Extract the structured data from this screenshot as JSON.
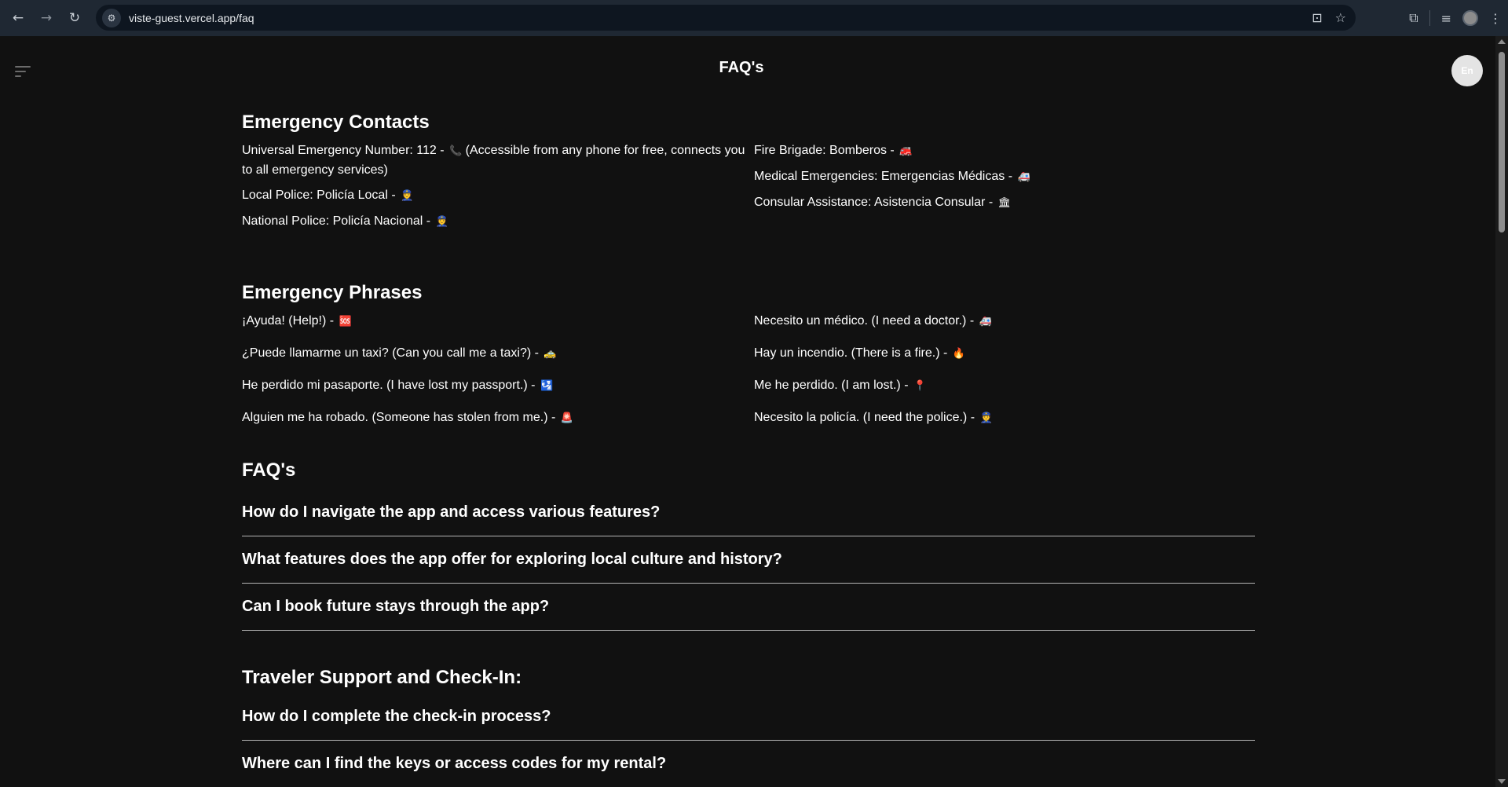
{
  "browser": {
    "url": "viste-guest.vercel.app/faq",
    "icons": [
      "back-arrow-icon",
      "forward-arrow-icon",
      "reload-icon",
      "site-info-icon",
      "install-app-icon",
      "bookmark-star-icon",
      "extensions-icon",
      "media-icon",
      "profile-avatar-icon",
      "more-menu-icon"
    ]
  },
  "header": {
    "title": "FAQ's",
    "language": "En"
  },
  "emergency_contacts": {
    "title": "Emergency Contacts",
    "left": [
      {
        "text": "Universal Emergency Number: 112 - ",
        "emoji": "📞",
        "tail": " (Accessible from any phone for free, connects you to all emergency services)"
      },
      {
        "text": "Local Police: Policía Local - ",
        "emoji": "👮"
      },
      {
        "text": "National Police: Policía Nacional - ",
        "emoji": "👮"
      }
    ],
    "right": [
      {
        "text": "Fire Brigade: Bomberos - ",
        "emoji": "🚒"
      },
      {
        "text": "Medical Emergencies: Emergencias Médicas - ",
        "emoji": "🚑"
      },
      {
        "text": "Consular Assistance: Asistencia Consular - ",
        "emoji": "🏛"
      }
    ]
  },
  "emergency_phrases": {
    "title": "Emergency Phrases",
    "left": [
      {
        "text": "¡Ayuda! (Help!) - ",
        "emoji": "🆘"
      },
      {
        "text": "¿Puede llamarme un taxi? (Can you call me a taxi?) - ",
        "emoji": "🚕"
      },
      {
        "text": "He perdido mi pasaporte. (I have lost my passport.) - ",
        "emoji": "🛂"
      },
      {
        "text": "Alguien me ha robado. (Someone has stolen from me.) - ",
        "emoji": "🚨"
      }
    ],
    "right": [
      {
        "text": "Necesito un médico. (I need a doctor.) - ",
        "emoji": "🚑"
      },
      {
        "text": "Hay un incendio. (There is a fire.) - ",
        "emoji": "🔥"
      },
      {
        "text": "Me he perdido. (I am lost.) - ",
        "emoji": "📍"
      },
      {
        "text": "Necesito la policía. (I need the police.) - ",
        "emoji": "👮"
      }
    ]
  },
  "faqs": {
    "title": "FAQ's",
    "questions": [
      "How do I navigate the app and access various features?",
      "What features does the app offer for exploring local culture and history?",
      "Can I book future stays through the app?"
    ]
  },
  "traveler_support": {
    "title": "Traveler Support and Check-In:",
    "questions": [
      "How do I complete the check-in process?",
      "Where can I find the keys or access codes for my rental?"
    ]
  }
}
